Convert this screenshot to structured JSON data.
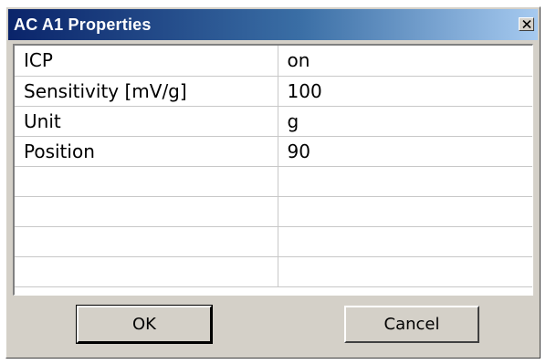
{
  "window": {
    "title": "AC A1 Properties"
  },
  "properties": [
    {
      "name": "ICP",
      "value": "on"
    },
    {
      "name": "Sensitivity [mV/g]",
      "value": "100"
    },
    {
      "name": "Unit",
      "value": "g"
    },
    {
      "name": "Position",
      "value": "90"
    },
    {
      "name": "",
      "value": ""
    },
    {
      "name": "",
      "value": ""
    },
    {
      "name": "",
      "value": ""
    },
    {
      "name": "",
      "value": ""
    }
  ],
  "buttons": {
    "ok_label": "OK",
    "cancel_label": "Cancel"
  },
  "icons": {
    "close": "close-icon"
  },
  "colors": {
    "titlebar_start": "#0a246a",
    "titlebar_end": "#a6caf0",
    "dialog_face": "#d4d0c8"
  }
}
